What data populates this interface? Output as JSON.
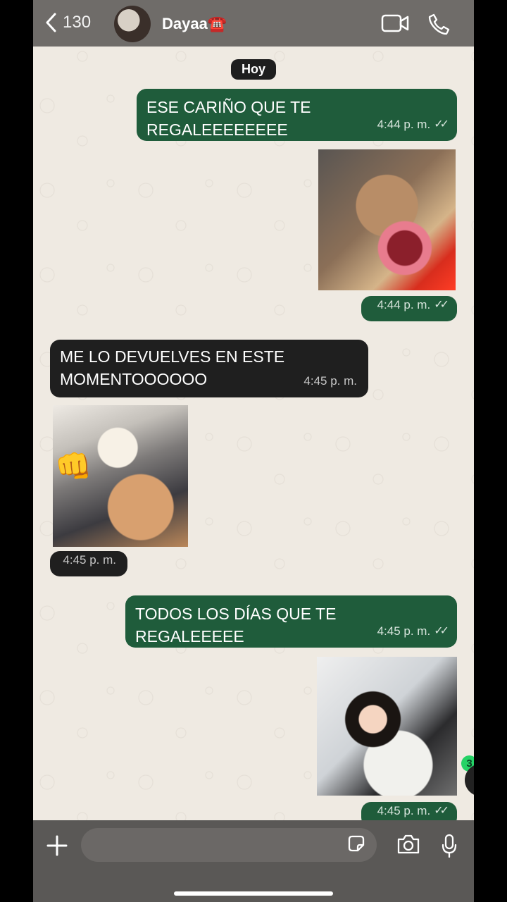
{
  "header": {
    "back_count": "130",
    "contact_name": "Dayaa☎️"
  },
  "chat": {
    "day_label": "Hoy",
    "messages": [
      {
        "type": "text",
        "direction": "outgoing",
        "text": "ESE CARIÑO QUE TE REGALEEEEEEEE",
        "time": "4:44 p. m.",
        "status": "read"
      },
      {
        "type": "image",
        "direction": "outgoing",
        "image": "screaming-monkey",
        "time": "4:44 p. m.",
        "status": "read"
      },
      {
        "type": "text",
        "direction": "incoming",
        "text_line1": "ME LO DEVUELVES EN ESTE",
        "text_line2": "MOMENTOOOOOO",
        "time": "4:45 p. m."
      },
      {
        "type": "image",
        "direction": "incoming",
        "image": "cat-with-fist",
        "emoji": "👊",
        "time": "4:45 p. m."
      },
      {
        "type": "text",
        "direction": "outgoing",
        "text": "TODOS LOS DÍAS QUE TE REGALEEEEE",
        "time": "4:45 p. m.",
        "status": "read"
      },
      {
        "type": "image",
        "direction": "outgoing",
        "image": "crying-baby",
        "time": "4:45 p. m.",
        "status": "read"
      }
    ],
    "unread_badge": "3"
  },
  "composer": {
    "value": "",
    "placeholder": ""
  },
  "colors": {
    "outgoing_bubble": "#1f5c3b",
    "incoming_bubble": "#1f1f1f",
    "chat_background": "#efeae2"
  }
}
